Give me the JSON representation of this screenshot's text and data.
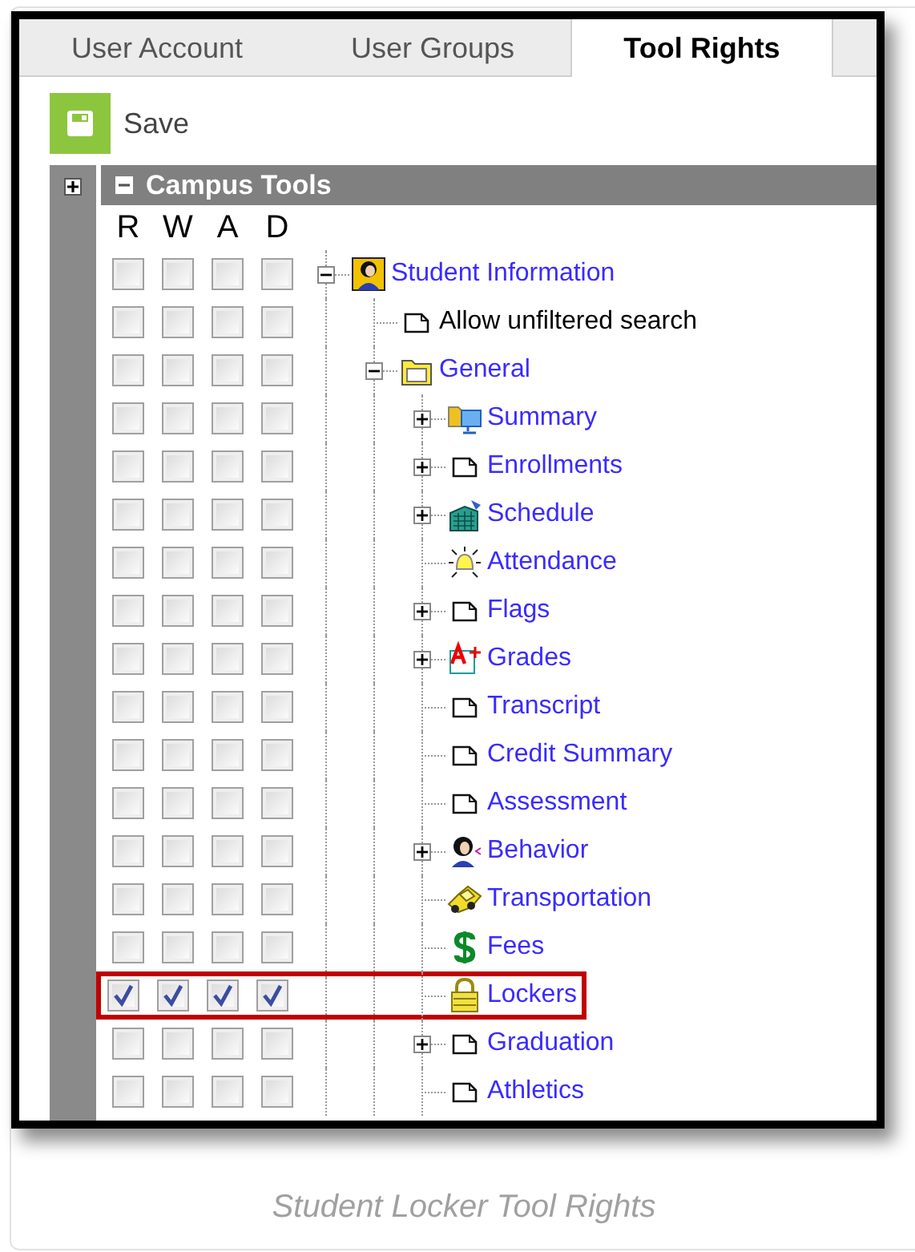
{
  "tabs": [
    {
      "label": "User Account",
      "selected": false
    },
    {
      "label": "User Groups",
      "selected": false
    },
    {
      "label": "Tool Rights",
      "selected": true
    }
  ],
  "toolbar": {
    "save": "Save"
  },
  "section": {
    "title": "Campus Tools",
    "expanded": true
  },
  "columns": [
    "R",
    "W",
    "A",
    "D"
  ],
  "tree": [
    {
      "label": "Student Information",
      "kind": "student",
      "link": true,
      "expanded": true,
      "highlighted": false,
      "checked": [
        false,
        false,
        false,
        false
      ],
      "children": [
        {
          "label": "Allow unfiltered search",
          "kind": "page",
          "link": false,
          "highlighted": false,
          "checked": [
            false,
            false,
            false,
            false
          ]
        },
        {
          "label": "General",
          "kind": "folder",
          "link": true,
          "expanded": true,
          "highlighted": false,
          "checked": [
            false,
            false,
            false,
            false
          ],
          "children": [
            {
              "label": "Summary",
              "kind": "monitor",
              "link": true,
              "expanded": false,
              "highlighted": false,
              "checked": [
                false,
                false,
                false,
                false
              ]
            },
            {
              "label": "Enrollments",
              "kind": "page",
              "link": true,
              "expanded": false,
              "highlighted": false,
              "checked": [
                false,
                false,
                false,
                false
              ]
            },
            {
              "label": "Schedule",
              "kind": "building",
              "link": true,
              "expanded": false,
              "highlighted": false,
              "checked": [
                false,
                false,
                false,
                false
              ]
            },
            {
              "label": "Attendance",
              "kind": "bell",
              "link": true,
              "highlighted": false,
              "checked": [
                false,
                false,
                false,
                false
              ]
            },
            {
              "label": "Flags",
              "kind": "page",
              "link": true,
              "expanded": false,
              "highlighted": false,
              "checked": [
                false,
                false,
                false,
                false
              ]
            },
            {
              "label": "Grades",
              "kind": "grades",
              "link": true,
              "expanded": false,
              "highlighted": false,
              "checked": [
                false,
                false,
                false,
                false
              ]
            },
            {
              "label": "Transcript",
              "kind": "page",
              "link": true,
              "highlighted": false,
              "checked": [
                false,
                false,
                false,
                false
              ]
            },
            {
              "label": "Credit Summary",
              "kind": "page",
              "link": true,
              "highlighted": false,
              "checked": [
                false,
                false,
                false,
                false
              ]
            },
            {
              "label": "Assessment",
              "kind": "page",
              "link": true,
              "highlighted": false,
              "checked": [
                false,
                false,
                false,
                false
              ]
            },
            {
              "label": "Behavior",
              "kind": "person",
              "link": true,
              "expanded": false,
              "highlighted": false,
              "checked": [
                false,
                false,
                false,
                false
              ]
            },
            {
              "label": "Transportation",
              "kind": "car",
              "link": true,
              "highlighted": false,
              "checked": [
                false,
                false,
                false,
                false
              ]
            },
            {
              "label": "Fees",
              "kind": "dollar",
              "link": true,
              "highlighted": false,
              "checked": [
                false,
                false,
                false,
                false
              ]
            },
            {
              "label": "Lockers",
              "kind": "lock",
              "link": true,
              "highlighted": true,
              "checked": [
                true,
                true,
                true,
                true
              ]
            },
            {
              "label": "Graduation",
              "kind": "page",
              "link": true,
              "expanded": false,
              "highlighted": false,
              "checked": [
                false,
                false,
                false,
                false
              ]
            },
            {
              "label": "Athletics",
              "kind": "page",
              "link": true,
              "highlighted": false,
              "checked": [
                false,
                false,
                false,
                false
              ]
            }
          ]
        }
      ]
    }
  ],
  "caption": "Student Locker Tool Rights"
}
